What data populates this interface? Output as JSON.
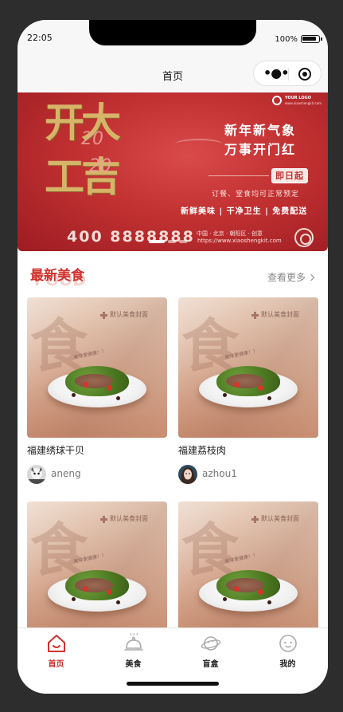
{
  "status": {
    "time": "22:05",
    "battery": "100%"
  },
  "nav": {
    "title": "首页"
  },
  "banner": {
    "big_line1": "开大",
    "big_line2": "工吉",
    "year1": "20",
    "year2": "20",
    "logo": "YOUR LOGO",
    "logo_sub": "www.xiaoshengkit.com",
    "headline1": "新年新气象",
    "headline2": "万事开门红",
    "badge": "即日起",
    "order_note": "订餐、堂食均可正常预定",
    "tags": "新鲜美味 | 干净卫生 | 免费配送",
    "phone": "400 8888888",
    "address": "中国 · 北京 · 朝阳区 · 创意",
    "website": "https://www.xiaoshengkit.com"
  },
  "section": {
    "title": "最新美食",
    "title_en": "FOOD",
    "more": "查看更多"
  },
  "cards": [
    {
      "name": "福建绣球干贝",
      "user": "aneng",
      "default_label": "默认美食封面",
      "slogan": "美味更健康！！"
    },
    {
      "name": "福建荔枝肉",
      "user": "azhou1",
      "default_label": "默认美食封面",
      "slogan": "美味更健康！！"
    },
    {
      "name": "",
      "user": "",
      "default_label": "默认美食封面",
      "slogan": "美味更健康！！"
    },
    {
      "name": "",
      "user": "",
      "default_label": "默认美食封面",
      "slogan": "美味更健康！！"
    }
  ],
  "tabbar": [
    {
      "label": "首页",
      "icon": "home-icon",
      "active": true
    },
    {
      "label": "美食",
      "icon": "cloche-icon",
      "active": false
    },
    {
      "label": "盲盒",
      "icon": "planet-icon",
      "active": false
    },
    {
      "label": "我的",
      "icon": "face-icon",
      "active": false
    }
  ],
  "colors": {
    "accent": "#d0312d",
    "banner_red": "#c23132",
    "gold": "#d6b46a"
  }
}
